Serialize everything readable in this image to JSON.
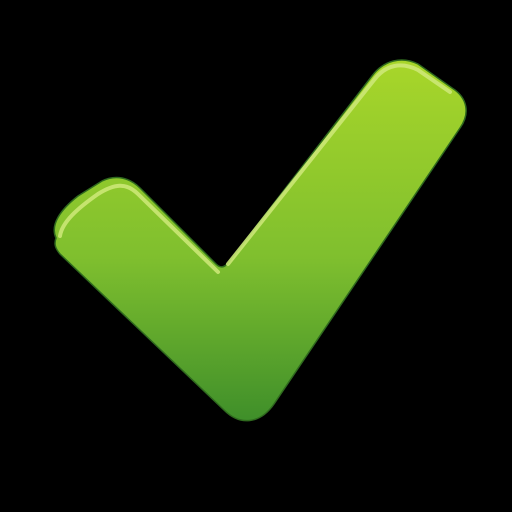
{
  "canvas": {
    "background_color": "#000000"
  },
  "icon": {
    "name": "checkmark-icon",
    "colors": {
      "top": "#a8d62a",
      "middle": "#7fbf2e",
      "bottom": "#3f8f2a",
      "highlight": "#cfe97a",
      "outline_shadow": "#2f6a1e"
    }
  }
}
